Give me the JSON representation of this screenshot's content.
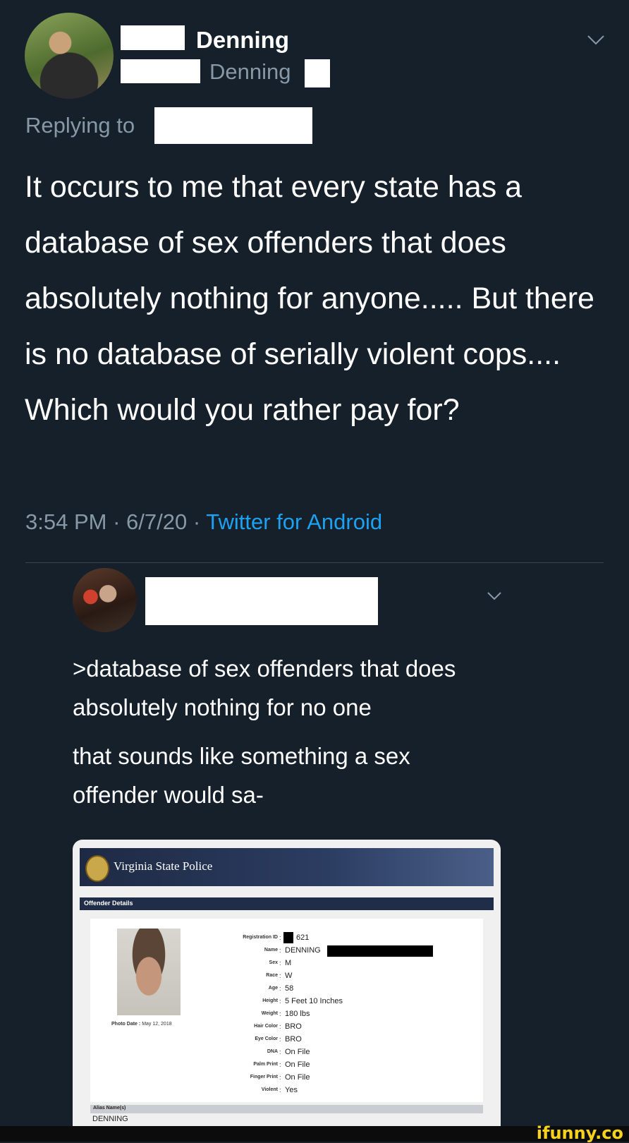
{
  "tweet": {
    "display_name": "Denning",
    "handle": "Denning",
    "replying_prefix": "Replying to",
    "text": "It occurs to me that every state has a database of sex offenders that does absolutely nothing for anyone..... But there is no database of serially violent cops.... Which would you rather pay for?",
    "time": "3:54 PM",
    "date": "6/7/20",
    "source": "Twitter for Android",
    "separator": "·"
  },
  "reply": {
    "text_line1": ">database of sex offenders that does absolutely nothing for no one",
    "text_line2": "that sounds like something a sex offender would sa-"
  },
  "card": {
    "title": "Virginia State Police",
    "section": "Offender Details",
    "photo_date_label": "Photo Date :",
    "photo_date": "May 12, 2018",
    "fields": [
      {
        "label": "Registration ID",
        "value": "621"
      },
      {
        "label": "Name",
        "value": "DENNING"
      },
      {
        "label": "Sex",
        "value": "M"
      },
      {
        "label": "Race",
        "value": "W"
      },
      {
        "label": "Age",
        "value": "58"
      },
      {
        "label": "Height",
        "value": "5 Feet 10 Inches"
      },
      {
        "label": "Weight",
        "value": "180 lbs"
      },
      {
        "label": "Hair Color",
        "value": "BRO"
      },
      {
        "label": "Eye Color",
        "value": "BRO"
      },
      {
        "label": "DNA",
        "value": "On File"
      },
      {
        "label": "Palm Print",
        "value": "On File"
      },
      {
        "label": "Finger Print",
        "value": "On File"
      },
      {
        "label": "Violent",
        "value": "Yes"
      }
    ],
    "alias_label": "Alias Name(s)",
    "alias_value": "DENNING"
  },
  "icons": {
    "chevron": "chevron-down-icon"
  },
  "watermark": "ifunny.co",
  "colors": {
    "background": "#15202b",
    "secondary_text": "#8899a6",
    "link": "#1da1f2"
  }
}
